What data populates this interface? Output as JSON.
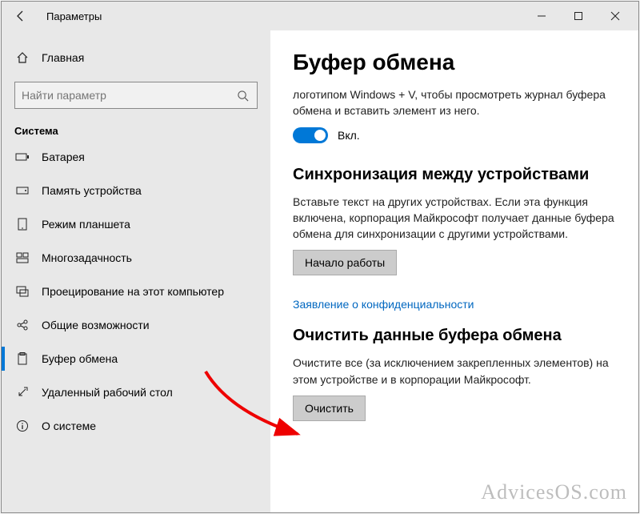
{
  "window": {
    "title": "Параметры"
  },
  "sidebar": {
    "home_label": "Главная",
    "search_placeholder": "Найти параметр",
    "section_label": "Система",
    "items": [
      {
        "label": "Батарея"
      },
      {
        "label": "Память устройства"
      },
      {
        "label": "Режим планшета"
      },
      {
        "label": "Многозадачность"
      },
      {
        "label": "Проецирование на этот компьютер"
      },
      {
        "label": "Общие возможности"
      },
      {
        "label": "Буфер обмена"
      },
      {
        "label": "Удаленный рабочий стол"
      },
      {
        "label": "О системе"
      }
    ]
  },
  "main": {
    "heading": "Буфер обмена",
    "history_desc": "логотипом Windows + V, чтобы просмотреть журнал буфера обмена и вставить элемент из него.",
    "toggle_label": "Вкл.",
    "sync_heading": "Синхронизация между устройствами",
    "sync_desc": "Вставьте текст на других устройствах. Если эта функция включена, корпорация Майкрософт получает данные буфера обмена для синхронизации с другими устройствами.",
    "sync_button": "Начало работы",
    "privacy_link": "Заявление о конфиденциальности",
    "clear_heading": "Очистить данные буфера обмена",
    "clear_desc": "Очистите все (за исключением закрепленных элементов) на этом устройстве и в корпорации Майкрософт.",
    "clear_button": "Очистить"
  },
  "watermark": "AdvicesOS.com"
}
